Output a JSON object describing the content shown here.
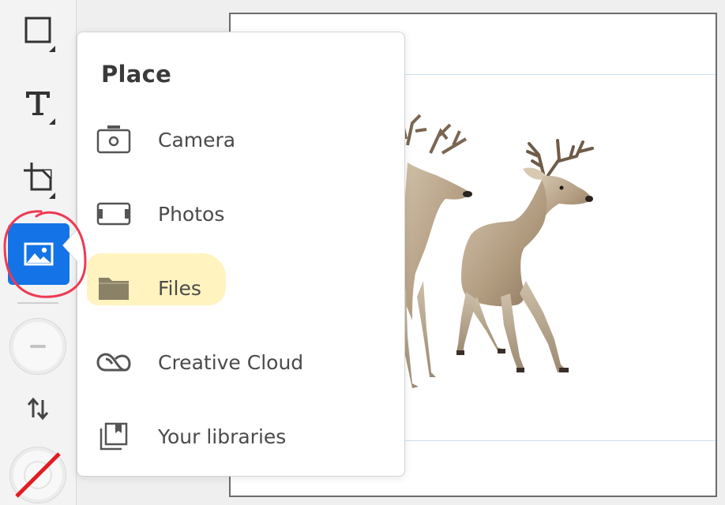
{
  "popover": {
    "title": "Place",
    "items": [
      {
        "label": "Camera",
        "icon": "camera-icon"
      },
      {
        "label": "Photos",
        "icon": "photos-icon"
      },
      {
        "label": "Files",
        "icon": "folder-icon"
      },
      {
        "label": "Creative Cloud",
        "icon": "creative-cloud-icon"
      },
      {
        "label": "Your libraries",
        "icon": "libraries-icon"
      }
    ]
  },
  "toolbar": {
    "tools": [
      {
        "icon": "rectangle-icon"
      },
      {
        "icon": "text-icon"
      },
      {
        "icon": "frame-icon"
      },
      {
        "icon": "image-icon",
        "active": true
      },
      {
        "icon": "stroke-width-icon"
      },
      {
        "icon": "swap-icon"
      },
      {
        "icon": "no-fill-icon"
      }
    ]
  },
  "colors": {
    "active_tool": "#1473e6",
    "annotation_circle": "#ee3a52",
    "files_highlight": "#fff1b5",
    "no_fill_slash": "#e31b23"
  }
}
